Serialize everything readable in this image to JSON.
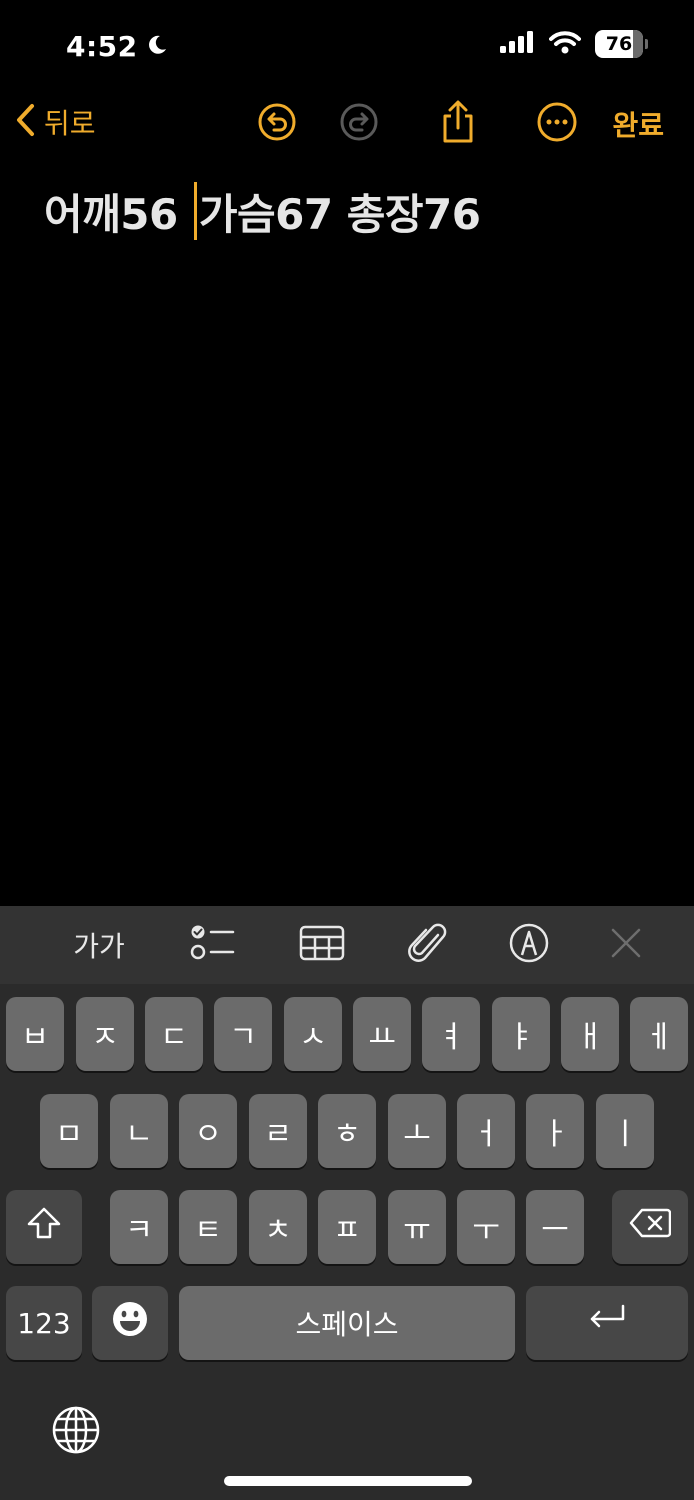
{
  "status": {
    "time": "4:52",
    "battery": "76"
  },
  "nav": {
    "back_label": "뒤로",
    "done_label": "완료"
  },
  "note": {
    "before_cursor": "어깨56 ",
    "after_cursor": "가슴67 총장76"
  },
  "toolbar": {
    "format_label": "가가"
  },
  "keyboard": {
    "row1": [
      "ㅂ",
      "ㅈ",
      "ㄷ",
      "ㄱ",
      "ㅅ",
      "ㅛ",
      "ㅕ",
      "ㅑ",
      "ㅐ",
      "ㅔ"
    ],
    "row2": [
      "ㅁ",
      "ㄴ",
      "ㅇ",
      "ㄹ",
      "ㅎ",
      "ㅗ",
      "ㅓ",
      "ㅏ",
      "ㅣ"
    ],
    "row3": [
      "ㅋ",
      "ㅌ",
      "ㅊ",
      "ㅍ",
      "ㅠ",
      "ㅜ",
      "ㅡ"
    ],
    "numbers_label": "123",
    "space_label": "스페이스"
  },
  "colors": {
    "accent": "#f0ac2c",
    "key": "#6b6b6b",
    "key_dark": "#474747",
    "keyboard_bg": "#2b2b2b",
    "toolbar_bg": "#333333"
  },
  "icons": [
    "moon-icon",
    "signal-icon",
    "wifi-icon",
    "battery-icon",
    "chevron-left-icon",
    "undo-icon",
    "redo-icon",
    "share-icon",
    "more-icon",
    "checklist-icon",
    "table-icon",
    "paperclip-icon",
    "markup-pen-icon",
    "close-icon",
    "shift-icon",
    "delete-icon",
    "emoji-icon",
    "return-icon",
    "globe-icon"
  ]
}
